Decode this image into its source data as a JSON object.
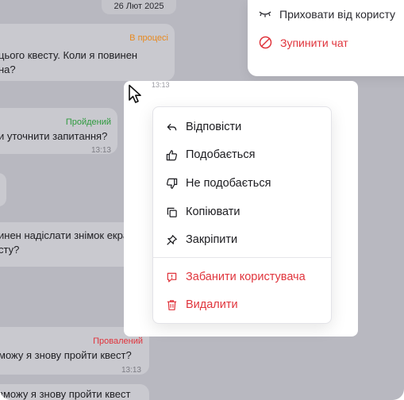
{
  "date_pill": "26 Лют 2025",
  "header_menu": {
    "hide_label": "Приховати від користу",
    "stop_label": "Зупинити чат"
  },
  "messages": [
    {
      "status": "В процесі",
      "status_color": "#e8891e",
      "lines": [
        "цього квесту. Коли я повинен",
        "на?"
      ],
      "time": ""
    },
    {
      "status": "Пройдений",
      "status_color": "#2e9a3e",
      "lines": [
        "и уточнити запитання?"
      ],
      "time": "13:13"
    },
    {
      "status": "",
      "lines": [
        "инен надіслати знімок екрана?",
        "сту?"
      ],
      "time": ""
    },
    {
      "status": "Провалений",
      "status_color": "#e0343c",
      "lines": [
        "можу я знову пройти квест?"
      ],
      "time": "13:13"
    },
    {
      "status": "",
      "lines": [
        "зможу я знову пройти квест"
      ],
      "time": ""
    }
  ],
  "selected_time": "13:13",
  "context_menu": {
    "items": [
      {
        "label": "Відповісти",
        "icon": "reply-icon",
        "danger": false
      },
      {
        "label": "Подобається",
        "icon": "thumbs-up-icon",
        "danger": false
      },
      {
        "label": "Не подобається",
        "icon": "thumbs-down-icon",
        "danger": false
      },
      {
        "label": "Копіювати",
        "icon": "copy-icon",
        "danger": false
      },
      {
        "label": "Закріпити",
        "icon": "pin-icon",
        "danger": false
      }
    ],
    "danger_items": [
      {
        "label": "Забанити користувача",
        "icon": "ban-user-icon",
        "danger": true
      },
      {
        "label": "Видалити",
        "icon": "trash-icon",
        "danger": true
      }
    ]
  },
  "colors": {
    "danger": "#e0343c",
    "overlay": "#b8b8c0"
  }
}
